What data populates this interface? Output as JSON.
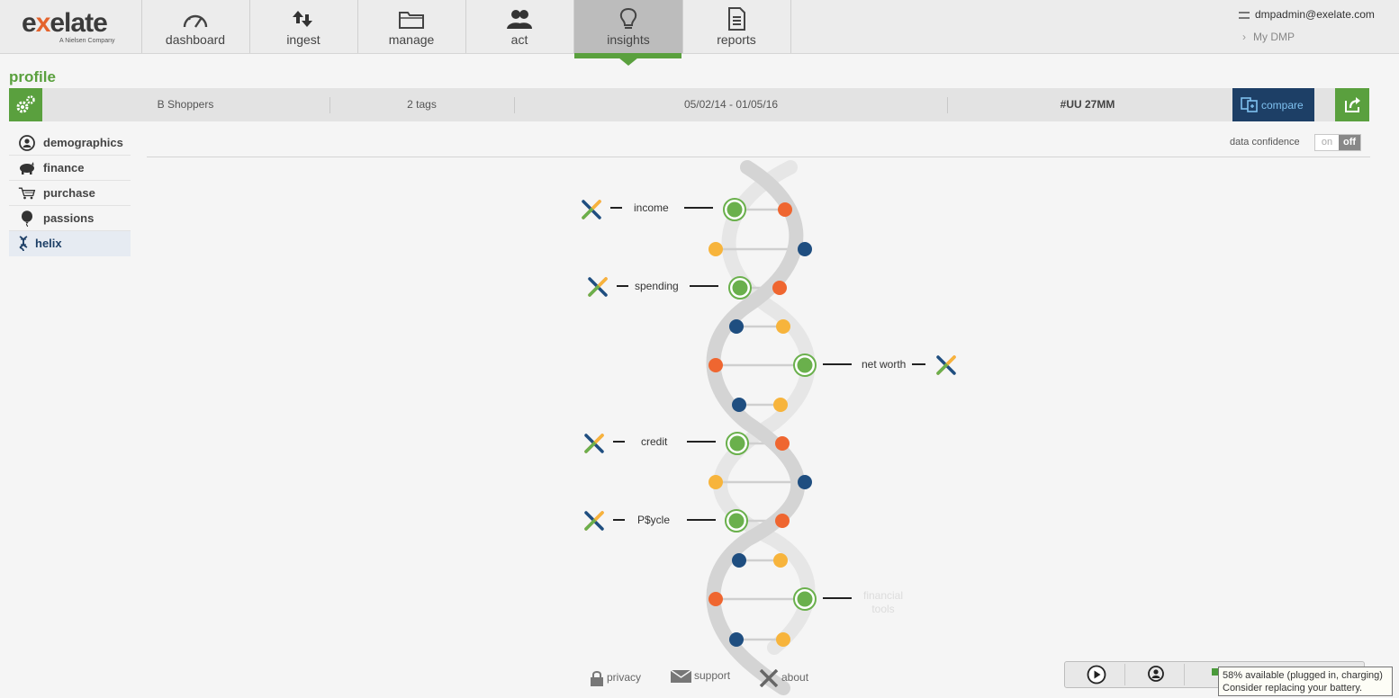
{
  "brand": {
    "name_pre": "e",
    "name_x": "x",
    "name_post": "elate",
    "tagline": "A Nielsen Company"
  },
  "nav": {
    "tabs": [
      {
        "label": "dashboard",
        "icon": "speedometer-icon"
      },
      {
        "label": "ingest",
        "icon": "up-down-arrows-icon"
      },
      {
        "label": "manage",
        "icon": "folder-icon"
      },
      {
        "label": "act",
        "icon": "people-icon"
      },
      {
        "label": "insights",
        "icon": "lightbulb-icon",
        "active": true
      },
      {
        "label": "reports",
        "icon": "document-icon"
      }
    ]
  },
  "user": {
    "email": "dmpadmin@exelate.com",
    "my_dmp": "My DMP"
  },
  "page": {
    "title": "profile"
  },
  "profile_bar": {
    "segment": "B Shoppers",
    "tags": "2 tags",
    "date_range": "05/02/14 - 01/05/16",
    "audience": "#UU 27MM",
    "compare_label": "compare"
  },
  "sidebar": {
    "items": [
      {
        "label": "demographics",
        "icon": "person-circle-icon"
      },
      {
        "label": "finance",
        "icon": "piggy-bank-icon"
      },
      {
        "label": "purchase",
        "icon": "shopping-cart-icon"
      },
      {
        "label": "passions",
        "icon": "balloon-icon"
      },
      {
        "label": "helix",
        "icon": "dna-icon",
        "active": true
      }
    ]
  },
  "data_confidence": {
    "label": "data confidence",
    "on": "on",
    "off": "off",
    "state": "off"
  },
  "helix": {
    "labels": {
      "income": "income",
      "spending": "spending",
      "net_worth": "net worth",
      "credit": "credit",
      "psycle": "P$ycle",
      "financial_tools_1": "financial",
      "financial_tools_2": "tools"
    },
    "colors": {
      "green": "#6ab04c",
      "orange": "#ef6630",
      "yellow": "#f7b43c",
      "navy": "#1f4e80",
      "strand": "#d8d8d8"
    }
  },
  "footer": {
    "privacy": "privacy",
    "support": "support",
    "about": "about"
  },
  "battery_tooltip": {
    "line1": "58% available (plugged in, charging)",
    "line2": "Consider replacing your battery."
  }
}
